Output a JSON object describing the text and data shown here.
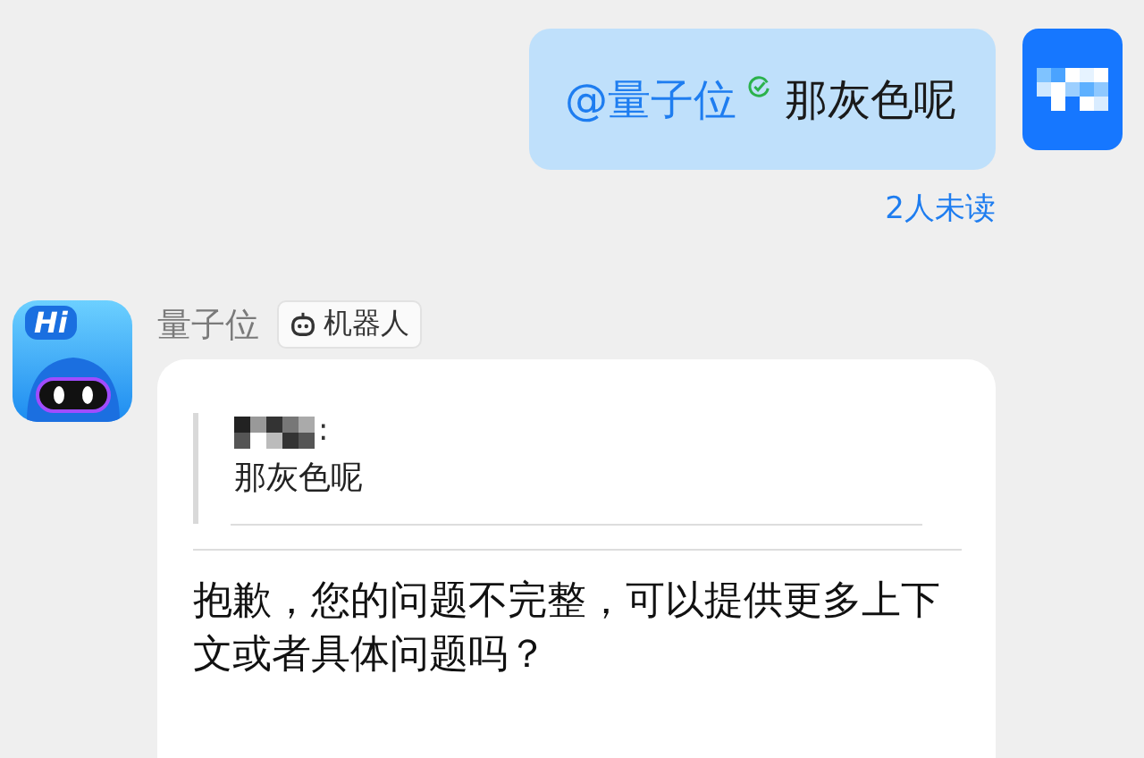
{
  "messages": [
    {
      "kind": "sent",
      "mention": "@量子位",
      "mention_confirmed": true,
      "text": "那灰色呢",
      "read_status": "2人未读"
    },
    {
      "kind": "received",
      "sender": "量子位",
      "sender_tag": "机器人",
      "avatar_text": "Hi",
      "quote": {
        "author_suffix": ":",
        "text": "那灰色呢"
      },
      "text": "抱歉，您的问题不完整，可以提供更多上下文或者具体问题吗？"
    }
  ]
}
